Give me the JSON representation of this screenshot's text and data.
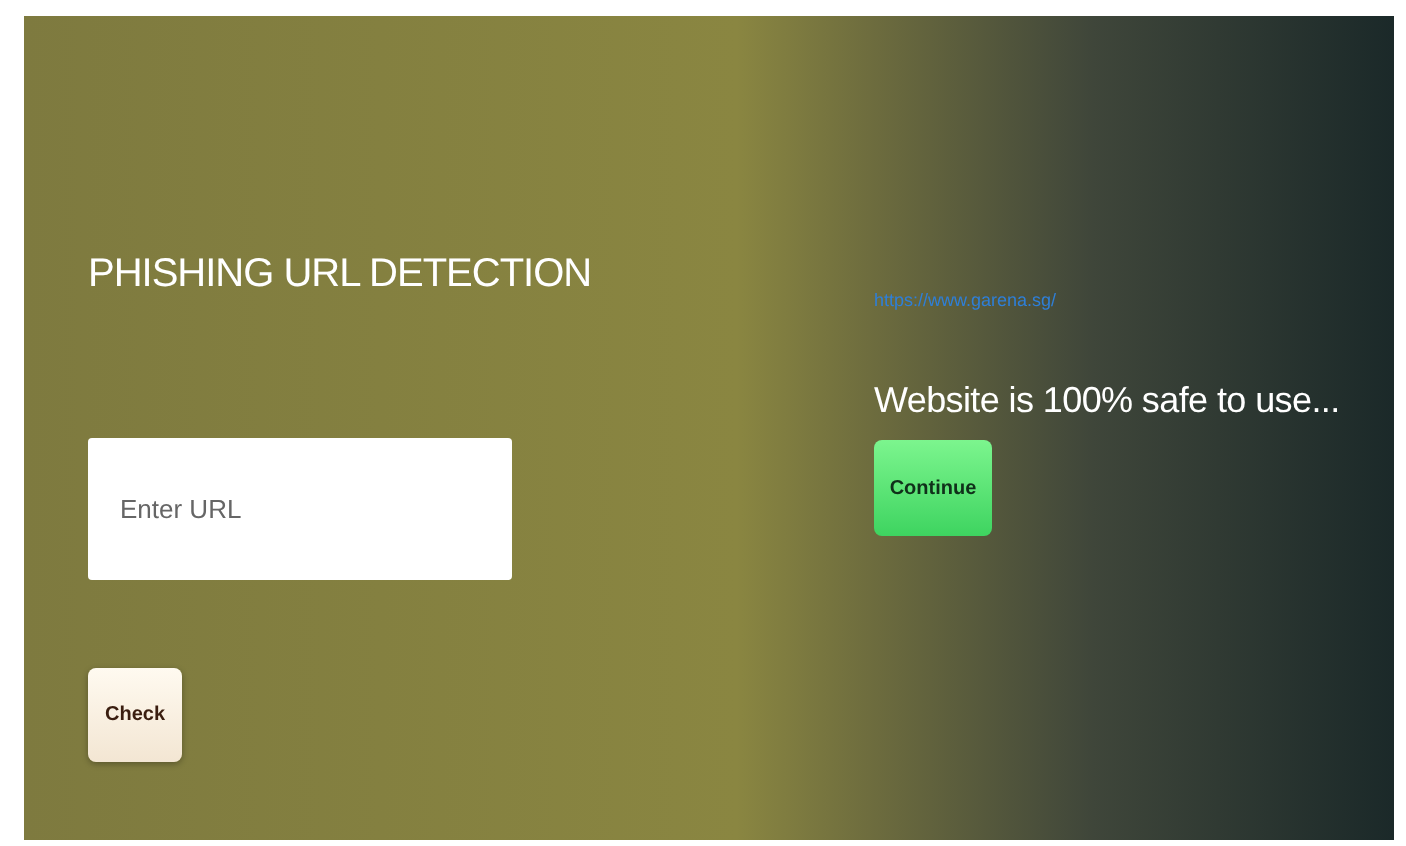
{
  "title": "PHISHING URL DETECTION",
  "url_input": {
    "placeholder": "Enter URL"
  },
  "check_button": {
    "label": "Check"
  },
  "result": {
    "url": "https://www.garena.sg/",
    "message": "Website is 100% safe to use...",
    "button": {
      "label": "Continue"
    }
  }
}
